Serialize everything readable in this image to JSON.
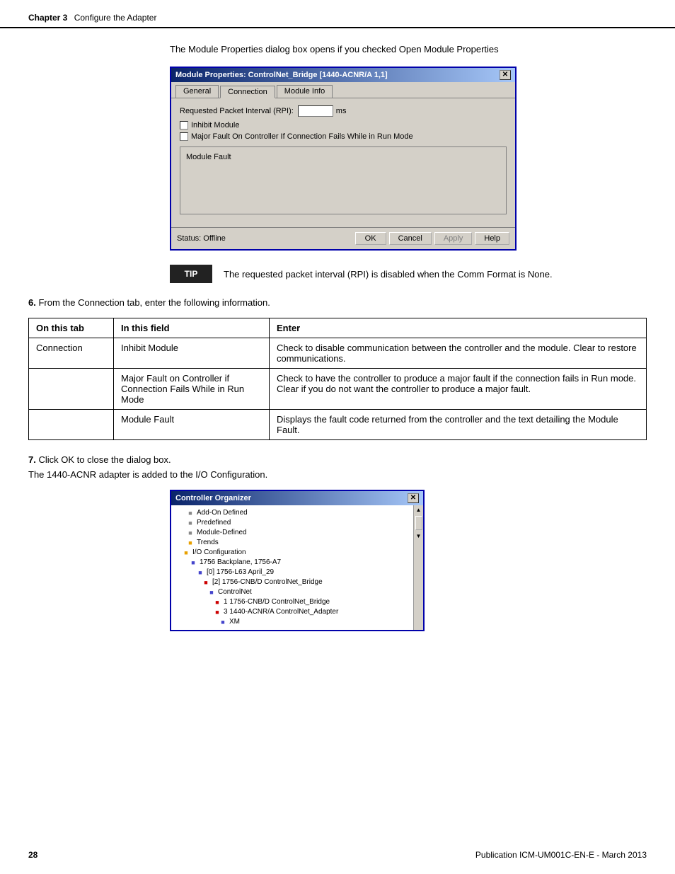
{
  "header": {
    "chapter": "Chapter 3",
    "subtitle": "Configure the Adapter"
  },
  "intro": {
    "text": "The Module Properties dialog box opens if you checked Open Module Properties"
  },
  "dialog": {
    "title": "Module Properties: ControlNet_Bridge [1440-ACNR/A 1,1]",
    "tabs": [
      "General",
      "Connection",
      "Module Info"
    ],
    "active_tab": "Connection",
    "rpi_label": "Requested Packet Interval (RPI):",
    "rpi_unit": "ms",
    "inhibit_label": "Inhibit Module",
    "major_fault_label": "Major Fault On Controller If Connection Fails While in Run Mode",
    "module_fault_label": "Module Fault",
    "status_label": "Status: Offline",
    "btn_ok": "OK",
    "btn_cancel": "Cancel",
    "btn_apply": "Apply",
    "btn_help": "Help"
  },
  "tip": {
    "badge": "TIP",
    "text": "The requested packet interval (RPI) is disabled when the Comm Format is None."
  },
  "step6": {
    "number": "6.",
    "text": "From the Connection tab, enter the following information."
  },
  "table": {
    "headers": [
      "On this tab",
      "In this field",
      "Enter"
    ],
    "rows": [
      {
        "tab": "Connection",
        "field": "Inhibit Module",
        "enter": "Check to disable communication between the controller and the module. Clear to restore communications."
      },
      {
        "tab": "",
        "field": "Major Fault on Controller if Connection Fails While in Run Mode",
        "enter": "Check to have the controller to produce a major fault if the connection fails in Run mode. Clear if you do not want the controller to produce a major fault."
      },
      {
        "tab": "",
        "field": "Module Fault",
        "enter": "Displays the fault code returned from the controller and the text detailing the Module Fault."
      }
    ]
  },
  "step7": {
    "number": "7.",
    "text": "Click OK to close the dialog box."
  },
  "adapter_text": "The 1440-ACNR adapter is added to the I/O Configuration.",
  "organizer": {
    "title": "Controller Organizer",
    "tree_items": [
      {
        "indent": 16,
        "icon": "gear",
        "label": "Add-On Defined"
      },
      {
        "indent": 16,
        "icon": "gear",
        "label": "Predefined"
      },
      {
        "indent": 16,
        "icon": "gear",
        "label": "Module-Defined"
      },
      {
        "indent": 16,
        "icon": "folder",
        "label": "Trends"
      },
      {
        "indent": 10,
        "icon": "folder",
        "label": "I/O Configuration"
      },
      {
        "indent": 20,
        "icon": "net",
        "label": "1756 Backplane, 1756-A7"
      },
      {
        "indent": 30,
        "icon": "net",
        "label": "[0] 1756-L63 April_29"
      },
      {
        "indent": 38,
        "icon": "bridge",
        "label": "[2] 1756-CNB/D ControlNet_Bridge"
      },
      {
        "indent": 46,
        "icon": "net",
        "label": "ControlNet"
      },
      {
        "indent": 54,
        "icon": "bridge",
        "label": "1 1756-CNB/D ControlNet_Bridge"
      },
      {
        "indent": 54,
        "icon": "bridge",
        "label": "3 1440-ACNR/A ControlNet_Adapter"
      },
      {
        "indent": 62,
        "icon": "net",
        "label": "XM"
      }
    ]
  },
  "footer": {
    "page": "28",
    "publication": "Publication ICM-UM001C-EN-E - March 2013"
  }
}
